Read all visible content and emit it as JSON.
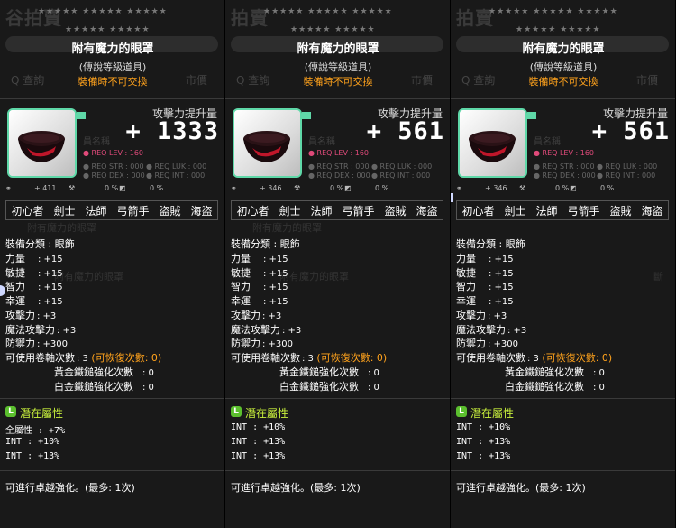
{
  "background": {
    "title": "拍賣",
    "title_p0": "谷拍賣",
    "search": "Q 查詢",
    "market": "市價",
    "bg_name_label": "員名稱",
    "under1": "附有魔力的眼罩",
    "under2": "附有魔力的眼罩",
    "under3": "斷"
  },
  "item": {
    "name": "附有魔力的眼罩",
    "grade": "(傳說等級道具)",
    "trade": "裝備時不可交換",
    "atk_label": "攻擊力提升量",
    "req_lev": "● REQ LEV :    160",
    "req_str": "● REQ STR : 000",
    "req_dex": "● REQ DEX : 000",
    "req_luk": "● REQ LUK : 000",
    "req_int": "● REQ INT : 000",
    "stars_row": "★★★★★ ★★★★★ ★★★★★",
    "stars_row2": "★★★★★ ★★★★★"
  },
  "jobs": [
    "初心者",
    "劍士",
    "法師",
    "弓箭手",
    "盜賊",
    "海盜"
  ],
  "stats": {
    "category_label": "裝備分類 : 眼飾",
    "str_label": "力量",
    "str_val": ": +15",
    "dex_label": "敏捷",
    "dex_val": ": +15",
    "int_label": "智力",
    "int_val": ": +15",
    "luk_label": "幸運",
    "luk_val": ": +15",
    "atk_label": "攻擊力",
    "atk_val": ": +3",
    "matk_label": "魔法攻擊力",
    "matk_val": ": +3",
    "def_label": "防禦力",
    "def_val": ": +300",
    "scroll_label": "可使用卷軸次數",
    "scroll_val": ": 3",
    "scroll_restore": "(可恢復次數: 0)",
    "gold_label": "黃金鐵鎚強化次數",
    "gold_val": ": 0",
    "plat_label": "白金鐵鎚強化次數",
    "plat_val": ": 0"
  },
  "potential_title": "潛在屬性",
  "potential_icon": "L",
  "footer": "可進行卓越強化。(最多: 1次)",
  "panels": [
    {
      "atk_value": "+ 1333",
      "stat_val1": "+ 411",
      "stat_pct1": "0 %",
      "stat_pct2": "0 %",
      "potentials": [
        {
          "label": "全屬性",
          "value": ": +7%"
        },
        {
          "label": "INT",
          "value": ": +10%"
        },
        {
          "label": "INT",
          "value": ": +13%"
        }
      ]
    },
    {
      "atk_value": "+ 561",
      "stat_val1": "+ 346",
      "stat_pct1": "0 %",
      "stat_pct2": "0 %",
      "potentials": [
        {
          "label": "INT",
          "value": ": +10%"
        },
        {
          "label": "INT",
          "value": ": +13%"
        },
        {
          "label": "INT",
          "value": ": +13%"
        }
      ]
    },
    {
      "atk_value": "+ 561",
      "stat_val1": "+ 346",
      "stat_pct1": "0 %",
      "stat_pct2": "0 %",
      "potentials": [
        {
          "label": "INT",
          "value": ": +10%"
        },
        {
          "label": "INT",
          "value": ": +13%"
        },
        {
          "label": "INT",
          "value": ": +13%"
        }
      ]
    }
  ],
  "colors": {
    "trade": "#ffa21c",
    "potential": "#c8f03c",
    "frame": "#5fd8a8",
    "req_lev": "#e04a7a"
  },
  "icons": [
    "eye-patch-icon",
    "potential-L-icon",
    "wrench-icon",
    "shield-icon",
    "link-icon"
  ]
}
